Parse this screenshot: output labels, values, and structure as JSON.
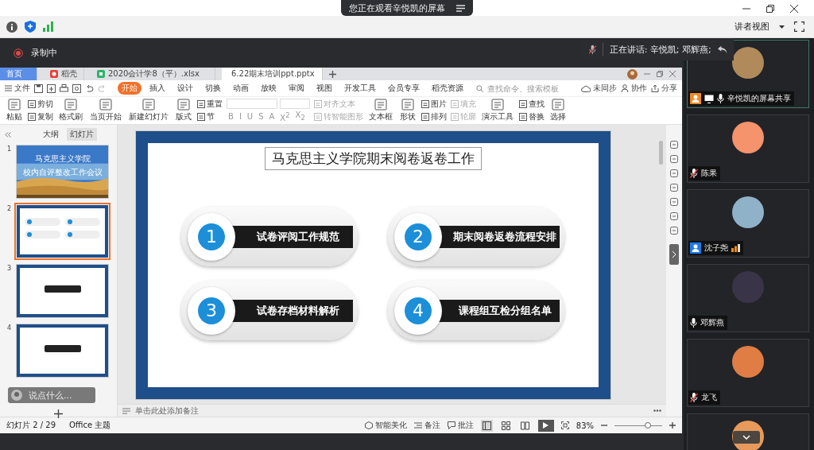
{
  "share_banner": {
    "text": "您正在观看辛悦凯的屏幕"
  },
  "speaking": {
    "text": "正在讲话: 辛悦凯; 邓辉燕;"
  },
  "view_mode": {
    "label": "讲者视图"
  },
  "recording": {
    "label": "录制中"
  },
  "wps": {
    "tabs": [
      {
        "label": "首页",
        "kind": "home",
        "selected": false
      },
      {
        "label": "稻壳",
        "kind": "docer",
        "selected": false
      },
      {
        "label": "2020会计学8（平）.xlsx",
        "kind": "sheet",
        "selected": false
      },
      {
        "label": "6.22期末培训ppt.pptx",
        "kind": "slides",
        "selected": true
      }
    ],
    "file_menu": "文件",
    "menu": [
      {
        "label": "开始",
        "selected": true
      },
      {
        "label": "插入",
        "selected": false
      },
      {
        "label": "设计",
        "selected": false
      },
      {
        "label": "切换",
        "selected": false
      },
      {
        "label": "动画",
        "selected": false
      },
      {
        "label": "放映",
        "selected": false
      },
      {
        "label": "审阅",
        "selected": false
      },
      {
        "label": "视图",
        "selected": false
      },
      {
        "label": "开发工具",
        "selected": false
      },
      {
        "label": "会员专享",
        "selected": false
      },
      {
        "label": "稻壳资源",
        "selected": false
      }
    ],
    "search": {
      "placeholder": "查找命令、搜索模板"
    },
    "sync_actions": [
      {
        "label": "未同步",
        "kind": "cloud"
      },
      {
        "label": "协作",
        "kind": "people"
      },
      {
        "label": "分享",
        "kind": "share"
      }
    ],
    "ribbon": [
      {
        "kind": "big",
        "label": "粘贴",
        "disabled": false
      },
      {
        "kind": "stack",
        "items": [
          {
            "label": "剪切",
            "disabled": false
          },
          {
            "label": "复制",
            "disabled": false
          }
        ]
      },
      {
        "kind": "big",
        "label": "格式刷",
        "disabled": false
      },
      {
        "kind": "big",
        "label": "当页开始",
        "disabled": false
      },
      {
        "kind": "big",
        "label": "新建幻灯片",
        "disabled": false
      },
      {
        "kind": "big",
        "label": "版式",
        "disabled": false
      },
      {
        "kind": "stack",
        "items": [
          {
            "label": "重置",
            "disabled": false
          },
          {
            "label": "节",
            "disabled": false
          }
        ]
      },
      {
        "kind": "font"
      },
      {
        "kind": "stack",
        "items": [
          {
            "label": "对齐文本",
            "disabled": true
          },
          {
            "label": "转智能图形",
            "disabled": true
          }
        ]
      },
      {
        "kind": "big",
        "label": "文本框",
        "disabled": false
      },
      {
        "kind": "big",
        "label": "形状",
        "disabled": false
      },
      {
        "kind": "stack",
        "items": [
          {
            "label": "图片",
            "disabled": false
          },
          {
            "label": "排列",
            "disabled": false
          }
        ]
      },
      {
        "kind": "stack",
        "items": [
          {
            "label": "填充",
            "disabled": true
          },
          {
            "label": "轮廓",
            "disabled": true
          }
        ]
      },
      {
        "kind": "big",
        "label": "演示工具",
        "disabled": false
      },
      {
        "kind": "stack",
        "items": [
          {
            "label": "查找",
            "disabled": false
          },
          {
            "label": "替换",
            "disabled": false
          }
        ]
      },
      {
        "kind": "big",
        "label": "选择",
        "disabled": false
      }
    ],
    "format_buttons": [
      "B",
      "I",
      "U",
      "S",
      "A",
      "X$^{2}$",
      "X$_{2}$"
    ],
    "panel_tabs": [
      {
        "label": "大纲",
        "selected": false
      },
      {
        "label": "幻灯片",
        "selected": true
      }
    ],
    "slides": [
      {
        "number": "1",
        "kind": "cover",
        "selected": false,
        "lines": [
          "马克思主义学院",
          "校内自评整改工作会议"
        ]
      },
      {
        "number": "2",
        "kind": "grid",
        "selected": true
      },
      {
        "number": "3",
        "kind": "banner",
        "selected": false
      },
      {
        "number": "4",
        "kind": "banner",
        "selected": false
      }
    ],
    "comment_box": {
      "placeholder": "说点什么..."
    },
    "slide": {
      "title": "马克思主义学院期末阅卷返卷工作",
      "items": [
        {
          "number": "1",
          "text": "试卷评阅工作规范"
        },
        {
          "number": "2",
          "text": "期末阅卷返卷流程安排"
        },
        {
          "number": "3",
          "text": "试卷存档材料解析"
        },
        {
          "number": "4",
          "text": "课程组互检分组名单"
        }
      ]
    },
    "notes": {
      "placeholder": "单击此处添加备注"
    },
    "status": {
      "slide_count": "幻灯片 2 / 29",
      "theme": "Office 主题",
      "actions": [
        {
          "label": "智能美化",
          "kind": "beautify"
        },
        {
          "label": "备注",
          "kind": "notes"
        },
        {
          "label": "批注",
          "kind": "comment"
        }
      ],
      "views": [
        {
          "kind": "normal",
          "selected": true
        },
        {
          "kind": "sorter",
          "selected": false
        },
        {
          "kind": "reading",
          "selected": false
        }
      ],
      "zoom": "83%",
      "zoom_slider": {
        "level": 0.7
      }
    }
  },
  "participants": [
    {
      "name": "辛悦凯的屏幕共享",
      "mic": {
        "muted": false
      },
      "host": true,
      "cohost": false,
      "sharing": true,
      "signal": false,
      "speaking": true,
      "color": "#b08a5a"
    },
    {
      "name": "陈果",
      "mic": {
        "muted": true
      },
      "host": false,
      "cohost": false,
      "sharing": false,
      "signal": false,
      "speaking": false,
      "color": "#f4936c"
    },
    {
      "name": "沈子尧",
      "host": false,
      "cohost": true,
      "sharing": false,
      "signal": true,
      "speaking": false,
      "color": "#8fb2c8"
    },
    {
      "name": "邓辉燕",
      "mic": {
        "muted": false
      },
      "host": false,
      "cohost": false,
      "sharing": false,
      "signal": false,
      "speaking": false,
      "color": "#3a3448"
    },
    {
      "name": "龙飞",
      "mic": {
        "muted": true
      },
      "host": false,
      "cohost": false,
      "sharing": false,
      "signal": false,
      "speaking": false,
      "color": "#e07d44"
    },
    {
      "host": false,
      "cohost": false,
      "sharing": false,
      "signal": false,
      "speaking": false,
      "color": "#e79a5a"
    }
  ]
}
